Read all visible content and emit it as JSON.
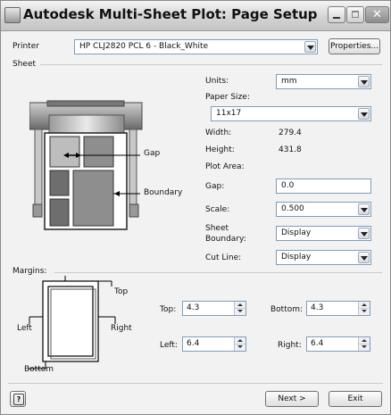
{
  "window": {
    "title": "Autodesk Multi-Sheet Plot: Page Setup",
    "close_glyph": "✕"
  },
  "printer": {
    "label": "Printer",
    "selected": "HP CLJ2820 PCL 6 - Black_White",
    "properties_label": "Properties..."
  },
  "sheet": {
    "label": "Sheet",
    "units_label": "Units:",
    "units_value": "mm",
    "paper_size_label": "Paper Size:",
    "paper_size_value": "11x17",
    "width_label": "Width:",
    "width_value": "279.4",
    "height_label": "Height:",
    "height_value": "431.8",
    "plot_area_label": "Plot Area:",
    "gap_label": "Gap:",
    "gap_value": "0.0",
    "scale_label": "Scale:",
    "scale_value": "0.500",
    "sheet_boundary_label_1": "Sheet",
    "sheet_boundary_label_2": "Boundary:",
    "sheet_boundary_value": "Display",
    "cut_line_label": "Cut Line:",
    "cut_line_value": "Display",
    "diagram_gap_label": "Gap",
    "diagram_boundary_label": "Boundary"
  },
  "margins": {
    "label": "Margins:",
    "diagram_top": "Top",
    "diagram_left": "Left",
    "diagram_right": "Right",
    "diagram_bottom": "Bottom",
    "top_label": "Top:",
    "top_value": "4.3",
    "bottom_label": "Bottom:",
    "bottom_value": "4.3",
    "left_label": "Left:",
    "left_value": "6.4",
    "right_label": "Right:",
    "right_value": "6.4"
  },
  "footer": {
    "help_glyph": "?",
    "next_label": "Next >",
    "exit_label": "Exit"
  }
}
